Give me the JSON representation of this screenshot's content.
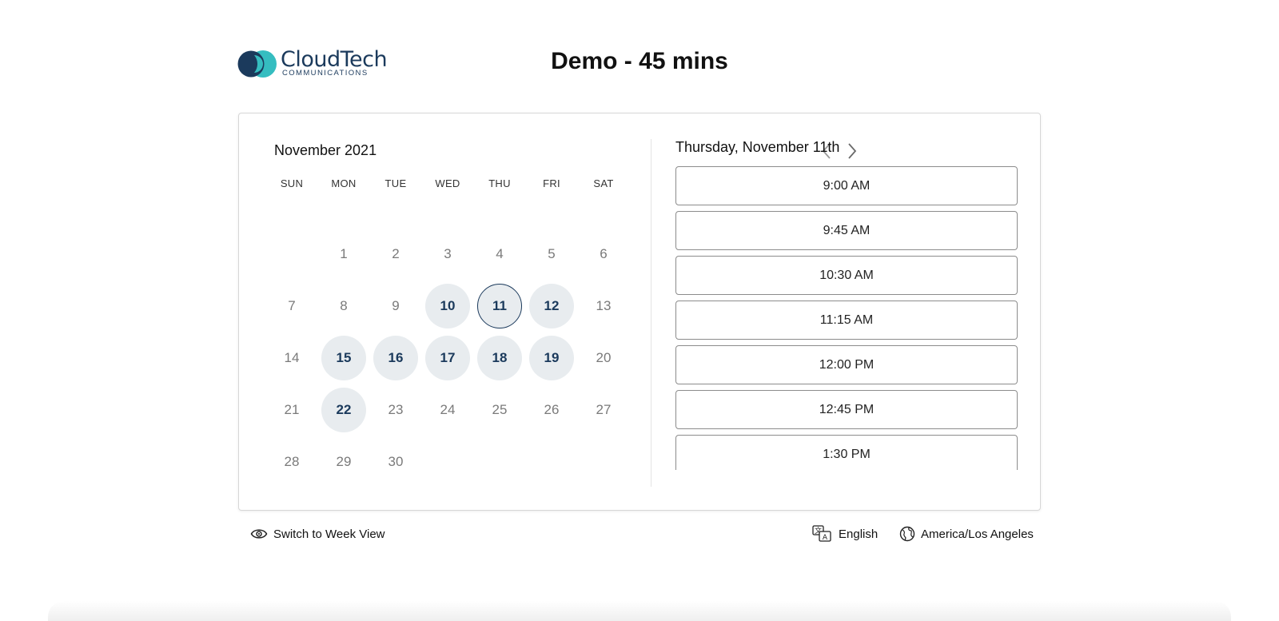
{
  "logo": {
    "name": "CloudTech",
    "subtitle": "COMMUNICATIONS"
  },
  "page_title": "Demo - 45 mins",
  "calendar": {
    "month_label": "November 2021",
    "weekdays": [
      "SUN",
      "MON",
      "TUE",
      "WED",
      "THU",
      "FRI",
      "SAT"
    ],
    "weeks": [
      [
        null,
        "1",
        "2",
        "3",
        "4",
        "5",
        "6"
      ],
      [
        "7",
        "8",
        "9",
        "10",
        "11",
        "12",
        "13"
      ],
      [
        "14",
        "15",
        "16",
        "17",
        "18",
        "19",
        "20"
      ],
      [
        "21",
        "22",
        "23",
        "24",
        "25",
        "26",
        "27"
      ],
      [
        "28",
        "29",
        "30",
        null,
        null,
        null,
        null
      ]
    ],
    "available_days": [
      "10",
      "11",
      "12",
      "15",
      "16",
      "17",
      "18",
      "19",
      "22"
    ],
    "selected_day": "11",
    "prev_icon": "chevron-left-icon",
    "next_icon": "chevron-right-icon"
  },
  "time_slots": {
    "date_heading": "Thursday, November 11th",
    "slots": [
      "9:00 AM",
      "9:45 AM",
      "10:30 AM",
      "11:15 AM",
      "12:00 PM",
      "12:45 PM",
      "1:30 PM"
    ]
  },
  "footer": {
    "week_view_label": "Switch to Week View",
    "language_label": "English",
    "timezone_label": "America/Los Angeles"
  },
  "colors": {
    "brand_navy": "#1b3a5c",
    "brand_teal": "#35bdc0",
    "available_bg": "#e8ecef"
  }
}
